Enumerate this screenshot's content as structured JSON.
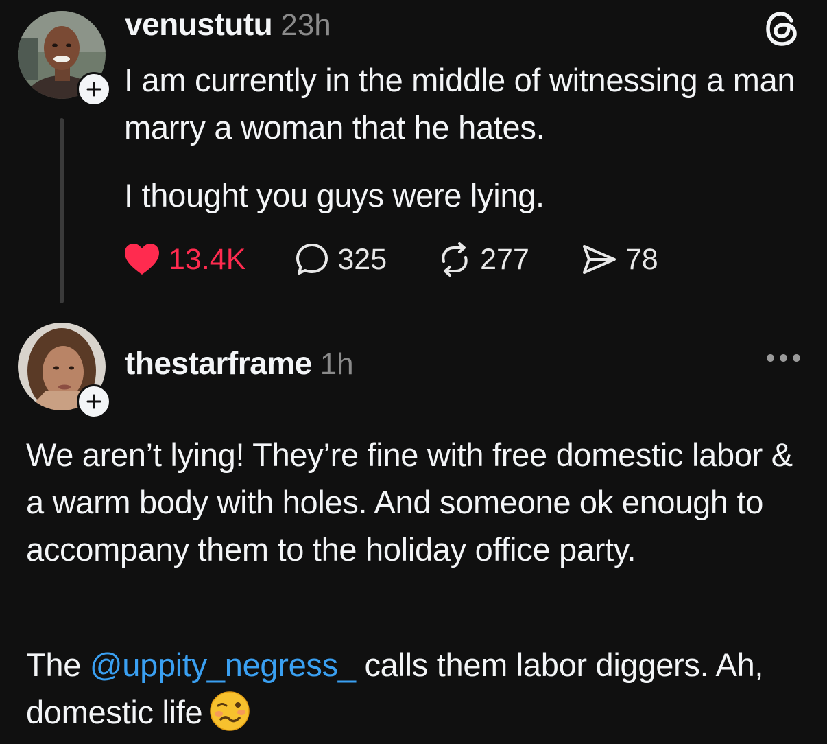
{
  "posts": [
    {
      "username": "venustutu",
      "time": "23h",
      "paragraphs": [
        "I am currently in the middle of witnessing a man marry a woman that he hates.",
        "I thought you guys were lying."
      ],
      "stats": {
        "likes": "13.4K",
        "replies": "325",
        "reposts": "277",
        "shares": "78"
      }
    },
    {
      "username": "thestarframe",
      "time": "1h",
      "paragraphs": [
        "We aren’t lying! They’re fine with free domestic labor & a warm body with holes. And someone ok enough to accompany them to the holiday office party."
      ],
      "last_paragraph": {
        "before": "The ",
        "mention": "@uppity_negress_",
        "after": " calls them labor diggers. Ah, domestic life"
      }
    }
  ],
  "colors": {
    "background": "#101010",
    "text": "#f3f5f7",
    "secondary": "#8a8a8a",
    "like": "#ff2b4f",
    "mention": "#3aa0f2"
  },
  "icons": {
    "like": "heart-icon",
    "reply": "speech-bubble-icon",
    "repost": "repost-arrows-icon",
    "share": "paper-plane-icon",
    "app": "threads-logo-icon",
    "more": "ellipsis-icon",
    "follow": "plus-icon",
    "emoji": "woozy-face-emoji"
  }
}
